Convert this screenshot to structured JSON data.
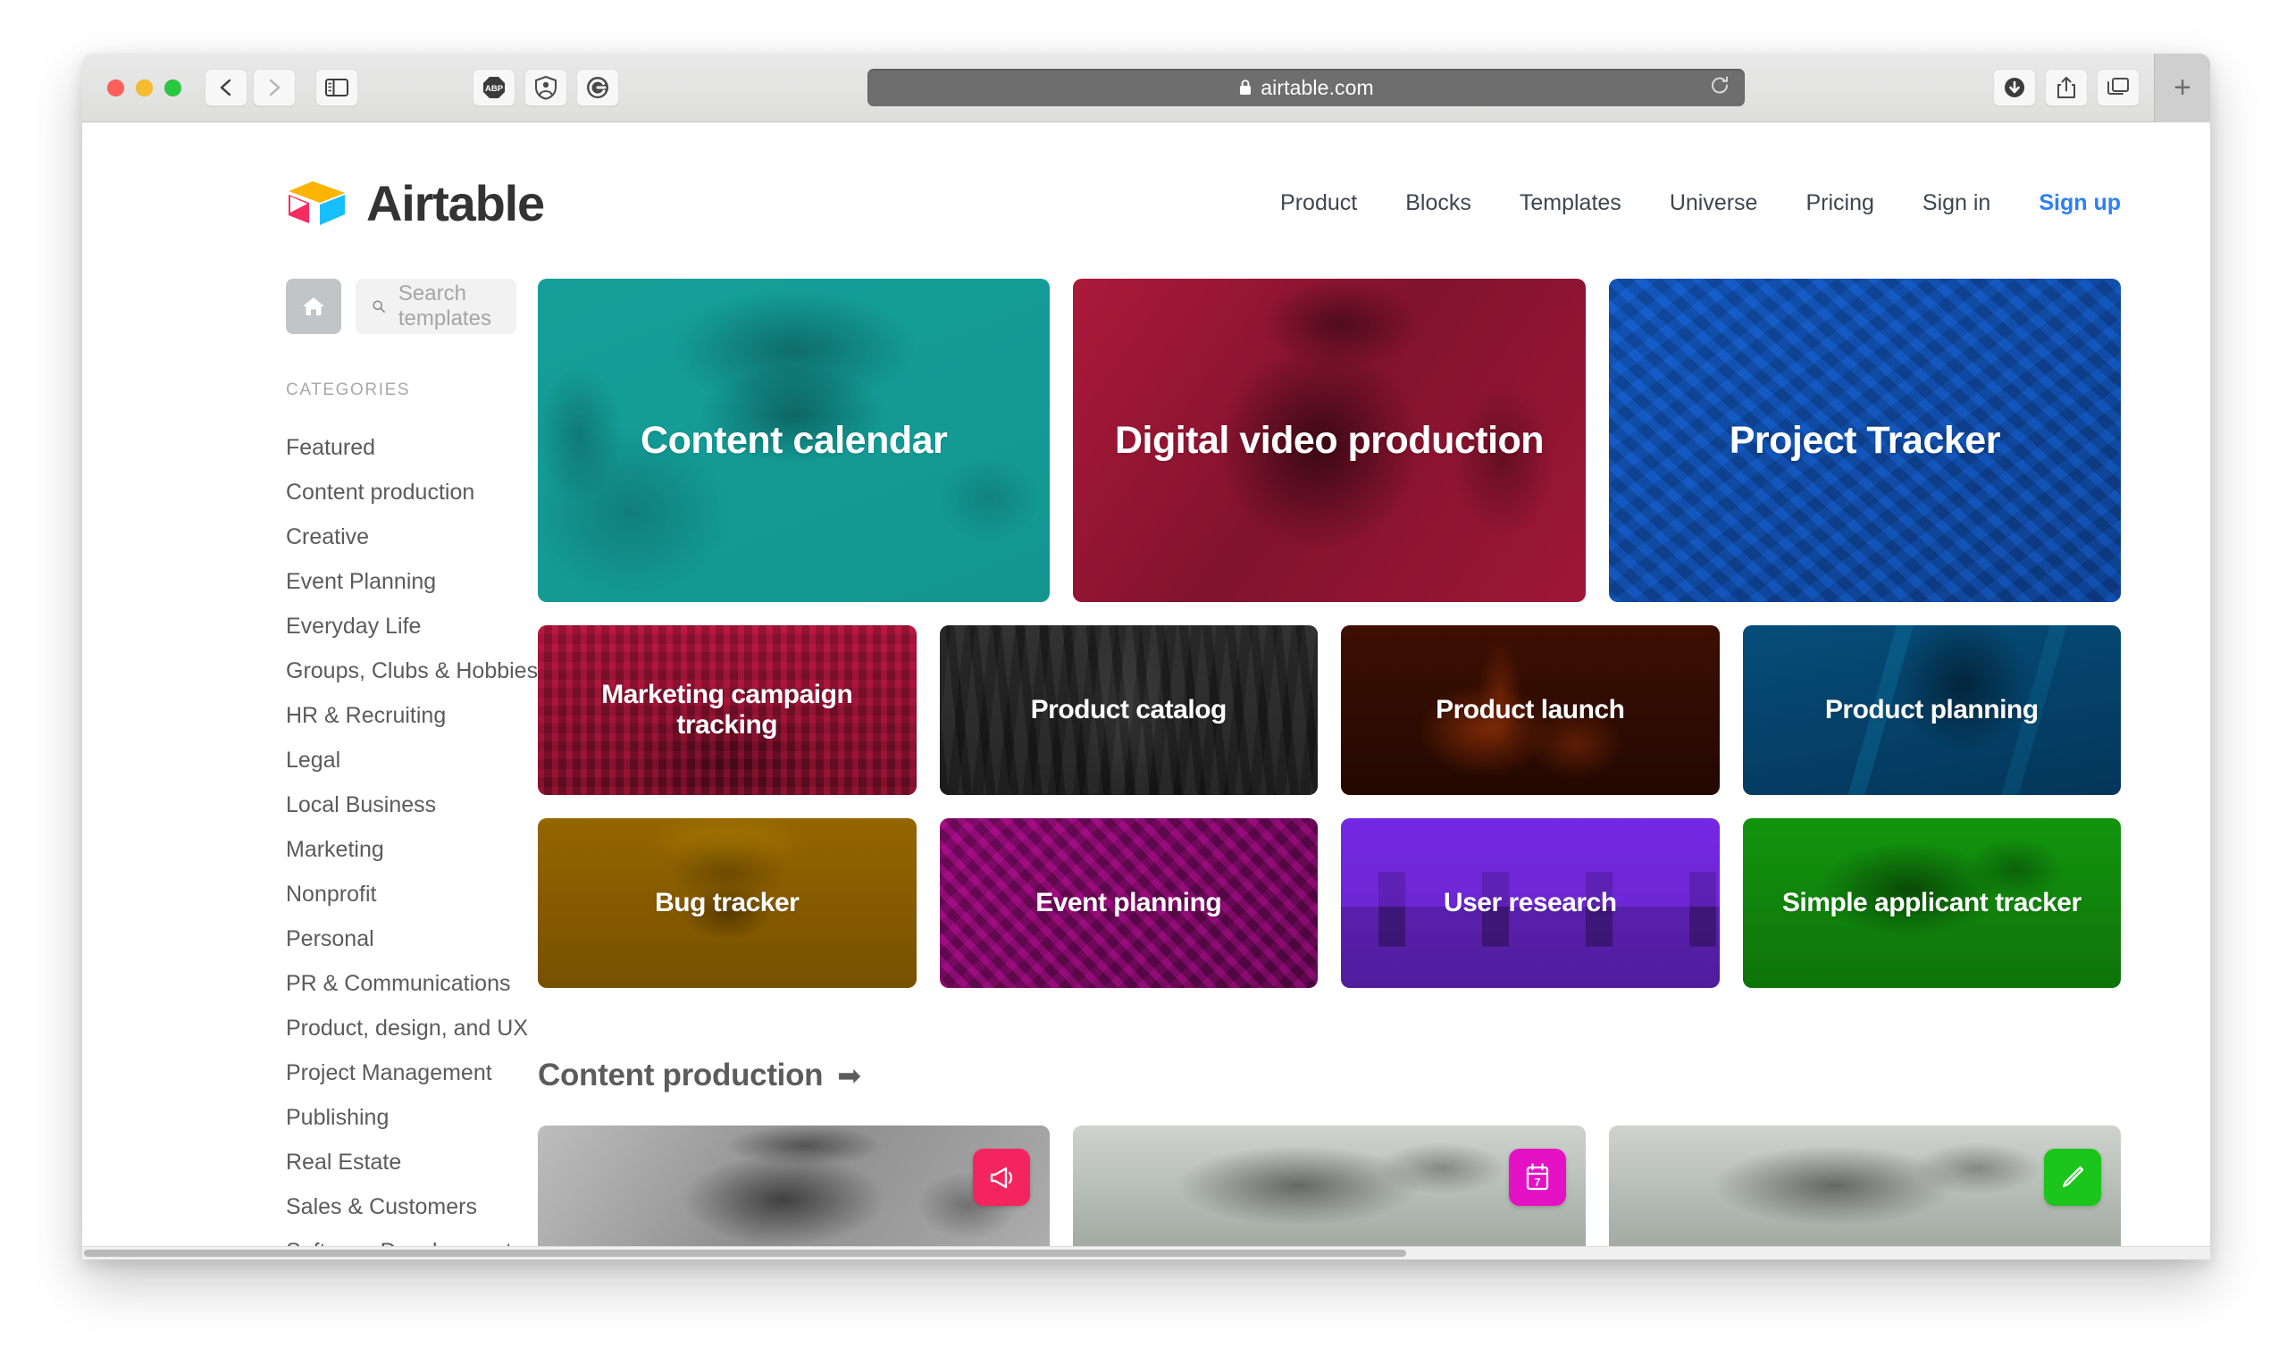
{
  "browser": {
    "traffic_lights": [
      "close",
      "minimize",
      "maximize"
    ],
    "back_label": "Back",
    "forward_label": "Forward",
    "sidebar_label": "Show sidebar",
    "extensions": [
      {
        "name": "adblock-plus",
        "label": "ABP"
      },
      {
        "name": "privacy-shield",
        "label": "Shield"
      },
      {
        "name": "grammarly",
        "label": "G"
      }
    ],
    "address": {
      "url": "airtable.com",
      "lock": "🔒",
      "reload_label": "Reload"
    },
    "right_buttons": [
      {
        "name": "downloads",
        "label": "Downloads"
      },
      {
        "name": "share",
        "label": "Share"
      },
      {
        "name": "tab-overview",
        "label": "Show tab overview"
      }
    ],
    "new_tab_label": "+"
  },
  "site": {
    "logo_text": "Airtable",
    "nav": [
      {
        "label": "Product",
        "highlight": false
      },
      {
        "label": "Blocks",
        "highlight": false
      },
      {
        "label": "Templates",
        "highlight": false
      },
      {
        "label": "Universe",
        "highlight": false
      },
      {
        "label": "Pricing",
        "highlight": false
      },
      {
        "label": "Sign in",
        "highlight": false
      },
      {
        "label": "Sign up",
        "highlight": true
      }
    ]
  },
  "sidebar": {
    "home_label": "Home",
    "search": {
      "placeholder": "Search templates",
      "value": ""
    },
    "categories_heading": "CATEGORIES",
    "categories": [
      {
        "label": "Featured"
      },
      {
        "label": "Content production"
      },
      {
        "label": "Creative"
      },
      {
        "label": "Event Planning"
      },
      {
        "label": "Everyday Life"
      },
      {
        "label": "Groups, Clubs & Hobbies"
      },
      {
        "label": "HR & Recruiting"
      },
      {
        "label": "Legal"
      },
      {
        "label": "Local Business"
      },
      {
        "label": "Marketing"
      },
      {
        "label": "Nonprofit"
      },
      {
        "label": "Personal"
      },
      {
        "label": "PR & Communications"
      },
      {
        "label": "Product, design, and UX"
      },
      {
        "label": "Project Management"
      },
      {
        "label": "Publishing"
      },
      {
        "label": "Real Estate"
      },
      {
        "label": "Sales & Customers"
      },
      {
        "label": "Software Development"
      }
    ]
  },
  "templates": {
    "hero": [
      {
        "title": "Content calendar",
        "color": "#17b3ad",
        "photo": "ph-desk"
      },
      {
        "title": "Digital video production",
        "color": "#e8214f",
        "photo": "ph-camera"
      },
      {
        "title": "Project Tracker",
        "color": "#1769e0",
        "photo": "ph-structure"
      }
    ],
    "row_two": [
      {
        "title": "Marketing campaign tracking",
        "color": "#d81b4a",
        "photo": "ph-city"
      },
      {
        "title": "Product catalog",
        "color": "#4a4a4a",
        "photo": "ph-warehouse"
      },
      {
        "title": "Product launch",
        "color": "#d24a0b",
        "photo": "ph-rocket"
      },
      {
        "title": "Product planning",
        "color": "#0b7fab",
        "photo": "ph-track"
      }
    ],
    "row_three": [
      {
        "title": "Bug tracker",
        "color": "#d8a800",
        "photo": "ph-beetle"
      },
      {
        "title": "Event planning",
        "color": "#cf10a8",
        "photo": "ph-keys"
      },
      {
        "title": "User research",
        "color": "#7b2bf0",
        "photo": "ph-room"
      },
      {
        "title": "Simple applicant tracker",
        "color": "#16b410",
        "photo": "ph-hands"
      }
    ]
  },
  "section": {
    "title": "Content production",
    "arrow": "➡",
    "cards": [
      {
        "badge_icon": "megaphone-icon",
        "badge_color": "#f4245e",
        "photo": "ph-camera"
      },
      {
        "badge_icon": "calendar-icon",
        "badge_color": "#e511c4",
        "badge_day": "7",
        "photo": "ph-hands"
      },
      {
        "badge_icon": "pencil-icon",
        "badge_color": "#1bc51b",
        "photo": "ph-hands"
      }
    ]
  }
}
